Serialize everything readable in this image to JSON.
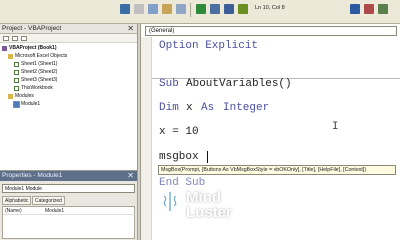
{
  "toolbar": {
    "position": "Ln 10, Col 8"
  },
  "project_pane": {
    "title": "Project - VBAProject",
    "tree": [
      {
        "label": "VBAProject (Book1)"
      },
      {
        "label": "Microsoft Excel Objects"
      },
      {
        "label": "Sheet1 (Sheet1)"
      },
      {
        "label": "Sheet2 (Sheet2)"
      },
      {
        "label": "Sheet3 (Sheet3)"
      },
      {
        "label": "ThisWorkbook"
      },
      {
        "label": "Modules"
      },
      {
        "label": "Module1"
      }
    ]
  },
  "properties_pane": {
    "title": "Properties - Module1",
    "object": "Module1 Module",
    "tabs": [
      "Alphabetic",
      "Categorized"
    ],
    "row_name": "(Name)",
    "row_value": "Module1"
  },
  "code_window": {
    "object_combo": "(General)",
    "lines": {
      "option": "Option Explicit",
      "sub_kw": "Sub",
      "sub_name": "AboutVariables()",
      "dim_kw": "Dim",
      "dim_var": "x",
      "as_kw": "As",
      "type_kw": "Integer",
      "assign": "x = 10",
      "msgbox": "msgbox",
      "end_sub": "End Sub"
    },
    "tooltip": "MsgBox(Prompt, [Buttons As VbMsgBoxStyle = vbOKOnly], [Title], [HelpFile], [Context])"
  },
  "watermark": {
    "line1": "Mind",
    "line2": "Luster"
  },
  "colors": {
    "keyword": "#4c51a3",
    "plain": "#222222"
  }
}
